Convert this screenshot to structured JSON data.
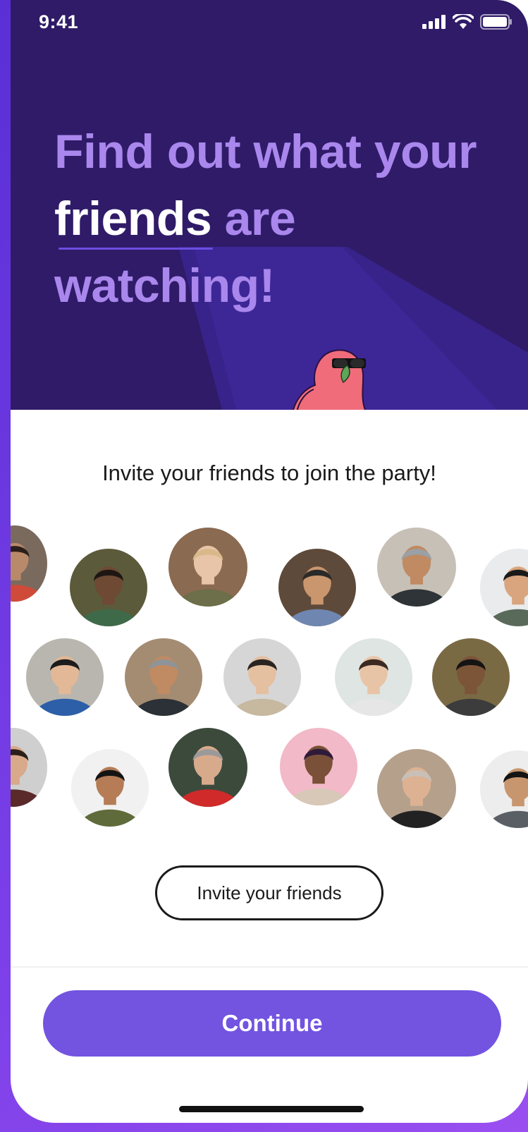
{
  "status_bar": {
    "time": "9:41",
    "icons": [
      "cellular-signal-icon",
      "wifi-icon",
      "battery-icon"
    ]
  },
  "hero": {
    "headline_before": "Find out what your ",
    "headline_highlight": "friends",
    "headline_after": " are watching!",
    "mascot": "parrot-with-sunglasses"
  },
  "invite_section": {
    "title": "Invite your friends to join the party!",
    "avatars": [
      {
        "id": "a1",
        "bg": "#7a6a5e",
        "skin": "#b98a6a",
        "shirt": "#d04a3a",
        "hair": "#2a1f1a"
      },
      {
        "id": "a2",
        "bg": "#5b5a3a",
        "skin": "#6e4a34",
        "shirt": "#3f6a4a",
        "hair": "#1e1612"
      },
      {
        "id": "a3",
        "bg": "#8a6a50",
        "skin": "#e8c5a8",
        "shirt": "#6d6e4a",
        "hair": "#d9b98a"
      },
      {
        "id": "a4",
        "bg": "#5e4a3a",
        "skin": "#c9966e",
        "shirt": "#6f86b0",
        "hair": "#2a2a2a"
      },
      {
        "id": "a5",
        "bg": "#c7c0b6",
        "skin": "#c08a62",
        "shirt": "#2e3438",
        "hair": "#9aa0a6"
      },
      {
        "id": "a6",
        "bg": "#e9ebec",
        "skin": "#d9a57e",
        "shirt": "#5a6a5a",
        "hair": "#1a1a1a"
      },
      {
        "id": "a7",
        "bg": "#b9b6b0",
        "skin": "#e3b896",
        "shirt": "#2d5fa8",
        "hair": "#1c1c1c"
      },
      {
        "id": "a8",
        "bg": "#a48c72",
        "skin": "#c08a62",
        "shirt": "#2b3136",
        "hair": "#8e9498"
      },
      {
        "id": "a9",
        "bg": "#d6d6d6",
        "skin": "#e4bfa0",
        "shirt": "#c7b8a0",
        "hair": "#2a2420"
      },
      {
        "id": "a10",
        "bg": "#dfe5e2",
        "skin": "#e8c4a6",
        "shirt": "#e6e6e6",
        "hair": "#3a2a22"
      },
      {
        "id": "a11",
        "bg": "#7a6a44",
        "skin": "#7c5438",
        "shirt": "#3c3c3c",
        "hair": "#141414"
      },
      {
        "id": "a12",
        "bg": "#cfcfcf",
        "skin": "#d8a98a",
        "shirt": "#5a2a2a",
        "hair": "#2a1f1a"
      },
      {
        "id": "a13",
        "bg": "#f1f1f1",
        "skin": "#b57c56",
        "shirt": "#5f6b3a",
        "hair": "#141414"
      },
      {
        "id": "a14",
        "bg": "#3c4a3c",
        "skin": "#d8aa8c",
        "shirt": "#d02a2a",
        "hair": "#9a9a9a"
      },
      {
        "id": "a15",
        "bg": "#f2b9c8",
        "skin": "#7a5038",
        "shirt": "#d8c8b8",
        "hair": "#301a3a"
      },
      {
        "id": "a16",
        "bg": "#b5a08c",
        "skin": "#dcb292",
        "shirt": "#222222",
        "hair": "#c8c0b8"
      },
      {
        "id": "a17",
        "bg": "#ededed",
        "skin": "#c8966e",
        "shirt": "#5a5f66",
        "hair": "#141414"
      }
    ],
    "invite_button": "Invite your friends"
  },
  "footer": {
    "continue_button": "Continue"
  },
  "colors": {
    "hero_bg": "#2f1b68",
    "headline_purple": "#a987ec",
    "accent": "#7254e0",
    "frame_gradient_start": "#5a2fd6"
  }
}
